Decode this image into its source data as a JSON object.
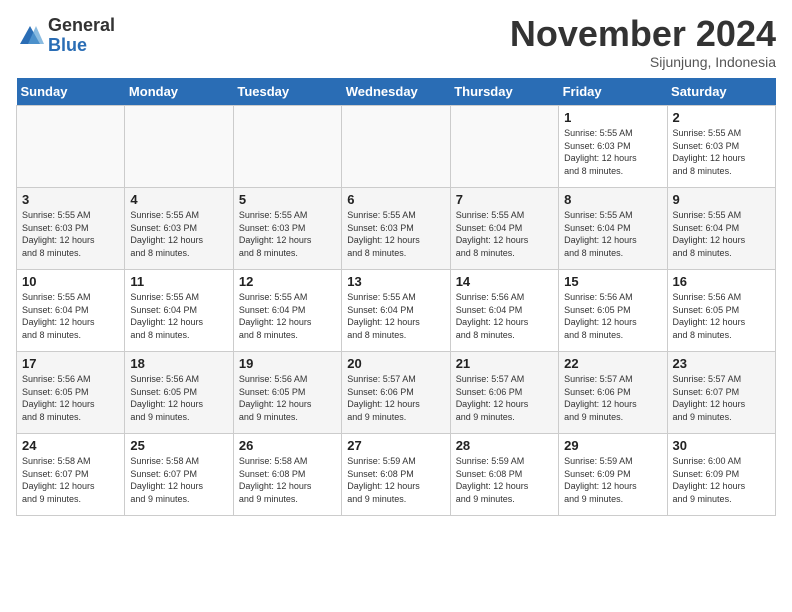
{
  "logo": {
    "general": "General",
    "blue": "Blue"
  },
  "header": {
    "month": "November 2024",
    "location": "Sijunjung, Indonesia"
  },
  "days_of_week": [
    "Sunday",
    "Monday",
    "Tuesday",
    "Wednesday",
    "Thursday",
    "Friday",
    "Saturday"
  ],
  "weeks": [
    [
      {
        "day": "",
        "info": ""
      },
      {
        "day": "",
        "info": ""
      },
      {
        "day": "",
        "info": ""
      },
      {
        "day": "",
        "info": ""
      },
      {
        "day": "",
        "info": ""
      },
      {
        "day": "1",
        "info": "Sunrise: 5:55 AM\nSunset: 6:03 PM\nDaylight: 12 hours\nand 8 minutes."
      },
      {
        "day": "2",
        "info": "Sunrise: 5:55 AM\nSunset: 6:03 PM\nDaylight: 12 hours\nand 8 minutes."
      }
    ],
    [
      {
        "day": "3",
        "info": "Sunrise: 5:55 AM\nSunset: 6:03 PM\nDaylight: 12 hours\nand 8 minutes."
      },
      {
        "day": "4",
        "info": "Sunrise: 5:55 AM\nSunset: 6:03 PM\nDaylight: 12 hours\nand 8 minutes."
      },
      {
        "day": "5",
        "info": "Sunrise: 5:55 AM\nSunset: 6:03 PM\nDaylight: 12 hours\nand 8 minutes."
      },
      {
        "day": "6",
        "info": "Sunrise: 5:55 AM\nSunset: 6:03 PM\nDaylight: 12 hours\nand 8 minutes."
      },
      {
        "day": "7",
        "info": "Sunrise: 5:55 AM\nSunset: 6:04 PM\nDaylight: 12 hours\nand 8 minutes."
      },
      {
        "day": "8",
        "info": "Sunrise: 5:55 AM\nSunset: 6:04 PM\nDaylight: 12 hours\nand 8 minutes."
      },
      {
        "day": "9",
        "info": "Sunrise: 5:55 AM\nSunset: 6:04 PM\nDaylight: 12 hours\nand 8 minutes."
      }
    ],
    [
      {
        "day": "10",
        "info": "Sunrise: 5:55 AM\nSunset: 6:04 PM\nDaylight: 12 hours\nand 8 minutes."
      },
      {
        "day": "11",
        "info": "Sunrise: 5:55 AM\nSunset: 6:04 PM\nDaylight: 12 hours\nand 8 minutes."
      },
      {
        "day": "12",
        "info": "Sunrise: 5:55 AM\nSunset: 6:04 PM\nDaylight: 12 hours\nand 8 minutes."
      },
      {
        "day": "13",
        "info": "Sunrise: 5:55 AM\nSunset: 6:04 PM\nDaylight: 12 hours\nand 8 minutes."
      },
      {
        "day": "14",
        "info": "Sunrise: 5:56 AM\nSunset: 6:04 PM\nDaylight: 12 hours\nand 8 minutes."
      },
      {
        "day": "15",
        "info": "Sunrise: 5:56 AM\nSunset: 6:05 PM\nDaylight: 12 hours\nand 8 minutes."
      },
      {
        "day": "16",
        "info": "Sunrise: 5:56 AM\nSunset: 6:05 PM\nDaylight: 12 hours\nand 8 minutes."
      }
    ],
    [
      {
        "day": "17",
        "info": "Sunrise: 5:56 AM\nSunset: 6:05 PM\nDaylight: 12 hours\nand 8 minutes."
      },
      {
        "day": "18",
        "info": "Sunrise: 5:56 AM\nSunset: 6:05 PM\nDaylight: 12 hours\nand 9 minutes."
      },
      {
        "day": "19",
        "info": "Sunrise: 5:56 AM\nSunset: 6:05 PM\nDaylight: 12 hours\nand 9 minutes."
      },
      {
        "day": "20",
        "info": "Sunrise: 5:57 AM\nSunset: 6:06 PM\nDaylight: 12 hours\nand 9 minutes."
      },
      {
        "day": "21",
        "info": "Sunrise: 5:57 AM\nSunset: 6:06 PM\nDaylight: 12 hours\nand 9 minutes."
      },
      {
        "day": "22",
        "info": "Sunrise: 5:57 AM\nSunset: 6:06 PM\nDaylight: 12 hours\nand 9 minutes."
      },
      {
        "day": "23",
        "info": "Sunrise: 5:57 AM\nSunset: 6:07 PM\nDaylight: 12 hours\nand 9 minutes."
      }
    ],
    [
      {
        "day": "24",
        "info": "Sunrise: 5:58 AM\nSunset: 6:07 PM\nDaylight: 12 hours\nand 9 minutes."
      },
      {
        "day": "25",
        "info": "Sunrise: 5:58 AM\nSunset: 6:07 PM\nDaylight: 12 hours\nand 9 minutes."
      },
      {
        "day": "26",
        "info": "Sunrise: 5:58 AM\nSunset: 6:08 PM\nDaylight: 12 hours\nand 9 minutes."
      },
      {
        "day": "27",
        "info": "Sunrise: 5:59 AM\nSunset: 6:08 PM\nDaylight: 12 hours\nand 9 minutes."
      },
      {
        "day": "28",
        "info": "Sunrise: 5:59 AM\nSunset: 6:08 PM\nDaylight: 12 hours\nand 9 minutes."
      },
      {
        "day": "29",
        "info": "Sunrise: 5:59 AM\nSunset: 6:09 PM\nDaylight: 12 hours\nand 9 minutes."
      },
      {
        "day": "30",
        "info": "Sunrise: 6:00 AM\nSunset: 6:09 PM\nDaylight: 12 hours\nand 9 minutes."
      }
    ]
  ]
}
